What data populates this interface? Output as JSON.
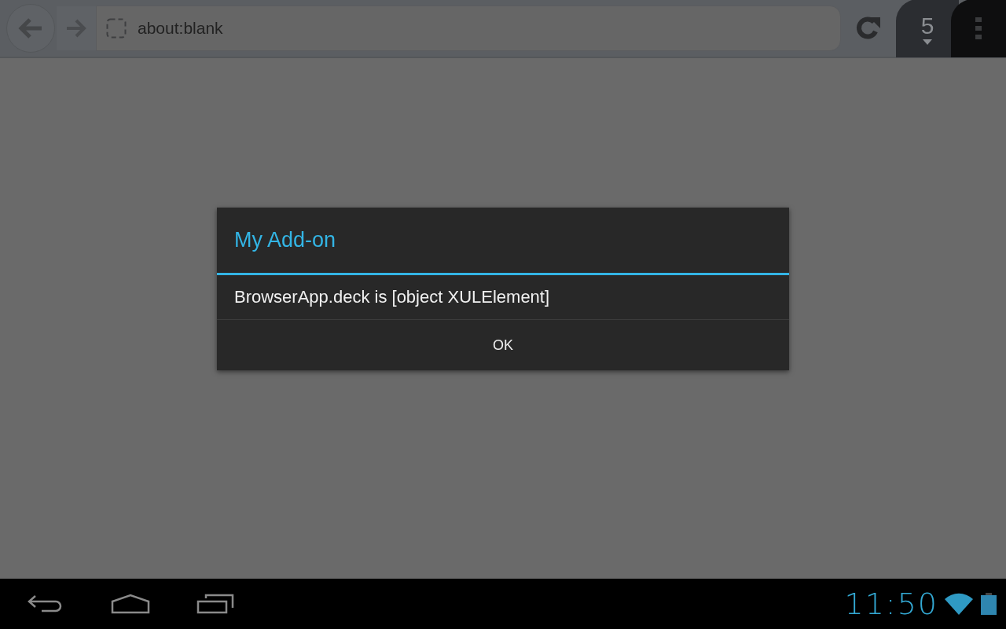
{
  "toolbar": {
    "url": "about:blank",
    "tab_count": "5"
  },
  "dialog": {
    "title": "My Add-on",
    "message": "BrowserApp.deck is [object XULElement]",
    "buttons": [
      "OK"
    ]
  },
  "status_bar": {
    "time": "11:50"
  }
}
